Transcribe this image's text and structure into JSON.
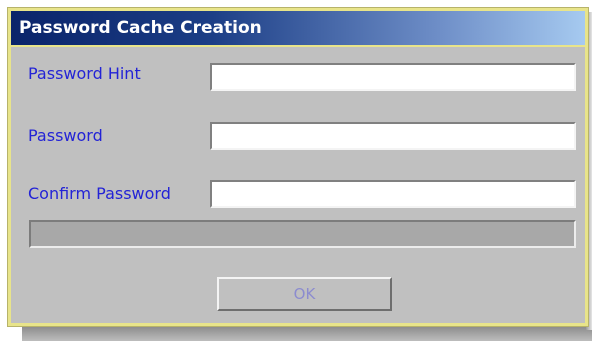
{
  "dialog": {
    "title": "Password Cache Creation"
  },
  "fields": {
    "hint": {
      "label": "Password Hint",
      "value": ""
    },
    "password": {
      "label": "Password",
      "value": ""
    },
    "confirm": {
      "label": "Confirm Password",
      "value": ""
    }
  },
  "progress": {
    "fraction": 0
  },
  "buttons": {
    "ok_label": "OK",
    "ok_enabled": false
  },
  "colors": {
    "label": "#2323d6",
    "title_start": "#0a246a",
    "title_end": "#a6caf0",
    "dialog_bg": "#c0c0c0",
    "frame": "#e8e48a"
  }
}
